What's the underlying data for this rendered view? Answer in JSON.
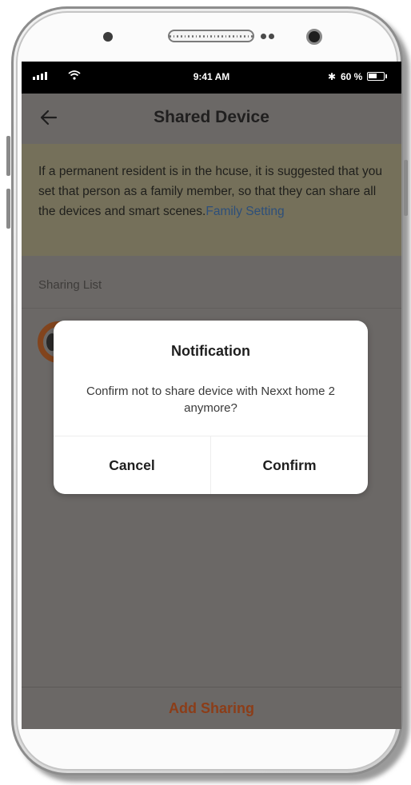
{
  "status_bar": {
    "time": "9:41 AM",
    "bluetooth_glyph": "✱",
    "battery": "60 %",
    "battery_level": 0.6,
    "icons": [
      "signal-icon",
      "wifi-icon",
      "bluetooth-icon",
      "battery-icon"
    ]
  },
  "header": {
    "title": "Shared Device",
    "back_icon": "back-arrow-icon"
  },
  "notice": {
    "text": "If a permanent resident is in the hcuse, it is suggested that you set that person as a family member, so that they can share all the devices and smart scenes.",
    "link": "Family Setting"
  },
  "sharing_list": {
    "label": "Sharing List"
  },
  "footer": {
    "add_label": "Add Sharing"
  },
  "dialog": {
    "title": "Notification",
    "message": "Confirm not to share device with Nexxt home 2 anymore?",
    "cancel": "Cancel",
    "confirm": "Confirm"
  },
  "colors": {
    "overlay_bg": "#6b6866",
    "notice_bg": "#75705a",
    "link": "#2d4f7a",
    "accent": "#8c3d18",
    "dialog_bg": "#ffffff"
  }
}
